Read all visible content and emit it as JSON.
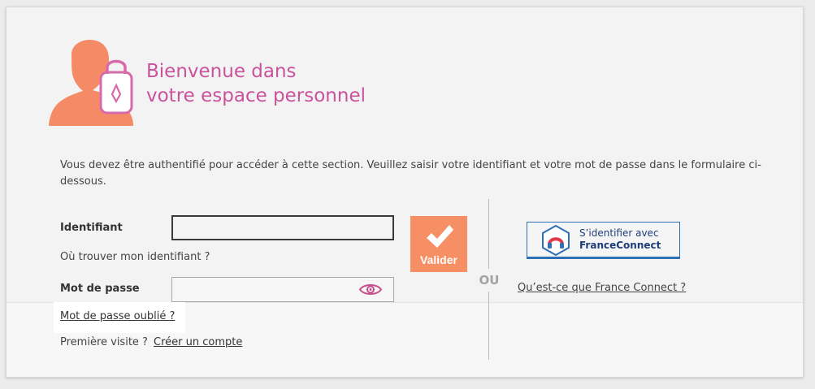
{
  "header": {
    "title_line1": "Bienvenue dans",
    "title_line2": "votre espace personnel"
  },
  "intro": "Vous devez être authentifié pour accéder à cette section. Veuillez saisir votre identifiant et votre mot de passe dans le formulaire ci-dessous.",
  "form": {
    "identifiant_label": "Identifiant",
    "identifiant_value": "",
    "where_link": "Où trouver mon identifiant ?",
    "password_label": "Mot de passe",
    "password_value": "",
    "forgot_link": "Mot de passe oublié ?",
    "first_visit_text": "Première visite ?",
    "create_account_link": "Créer un compte",
    "validate_label": "Valider"
  },
  "divider": {
    "or_text": "OU"
  },
  "france_connect": {
    "button_line1": "S’identifier avec",
    "button_line2": "FranceConnect",
    "info_link": "Qu’est-ce que France Connect ?"
  },
  "colors": {
    "title": "#c9529c",
    "accent_orange": "#f68f63",
    "france_connect_blue": "#2f6fb5"
  },
  "icons": [
    "user-lock-icon",
    "checkmark-icon",
    "eye-icon",
    "franceconnect-logo-icon"
  ]
}
